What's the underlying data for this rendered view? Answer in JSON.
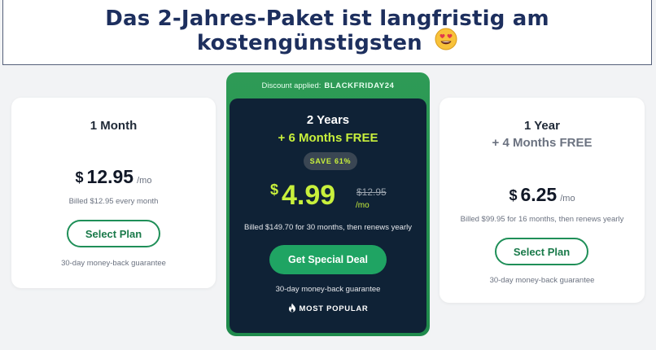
{
  "banner": {
    "title": "Das 2-Jahres-Paket ist langfristig am kostengünstigsten",
    "emoji_icon": "heart-eyes-emoji-icon"
  },
  "plans": [
    {
      "name": "1 Month",
      "subtitle": "",
      "currency": "$",
      "price": "12.95",
      "per": "/mo",
      "billed": "Billed $12.95 every month",
      "button": "Select Plan",
      "guarantee": "30-day money-back guarantee"
    },
    {
      "name": "2 Years",
      "subtitle": "+ 6 Months FREE",
      "discount_label": "Discount applied:",
      "discount_code": "BLACKFRIDAY24",
      "save_badge": "SAVE 61%",
      "currency": "$",
      "price": "4.99",
      "old_price": "$12.95",
      "per": "/mo",
      "billed": "Billed $149.70 for 30 months, then renews yearly",
      "button": "Get Special Deal",
      "guarantee": "30-day money-back guarantee",
      "badge": "MOST POPULAR"
    },
    {
      "name": "1 Year",
      "subtitle": "+ 4 Months FREE",
      "currency": "$",
      "price": "6.25",
      "per": "/mo",
      "billed": "Billed $99.95 for 16 months, then renews yearly",
      "button": "Select Plan",
      "guarantee": "30-day money-back guarantee"
    }
  ],
  "colors": {
    "banner_text": "#1d2f5e",
    "accent_green": "#1fa463",
    "featured_bg": "#0f2236",
    "highlight_yellow": "#c8f03c"
  }
}
